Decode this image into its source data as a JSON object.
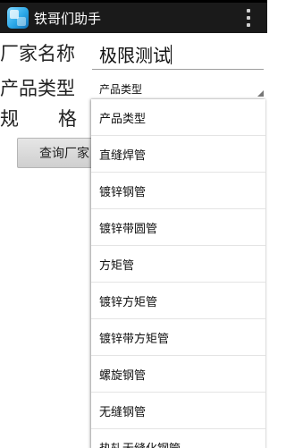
{
  "app": {
    "title": "铁哥们助手",
    "icon": "app-cube-icon"
  },
  "form": {
    "vendor_label": "厂家名称",
    "vendor_value": "极限测试",
    "type_label": "产品类型",
    "type_selected": "产品类型",
    "spec_label_1": "规",
    "spec_label_2": "格",
    "query_button": "查询厂家"
  },
  "dropdown": {
    "items": [
      "产品类型",
      "直缝焊管",
      "镀锌钢管",
      "镀锌带圆管",
      "方矩管",
      "镀锌方矩管",
      "镀锌带方矩管",
      "螺旋钢管",
      "无缝钢管",
      "热轧无缝化钢管"
    ]
  },
  "colors": {
    "actionbar": "#1a1a1a",
    "accent": "#2aa7e8"
  }
}
